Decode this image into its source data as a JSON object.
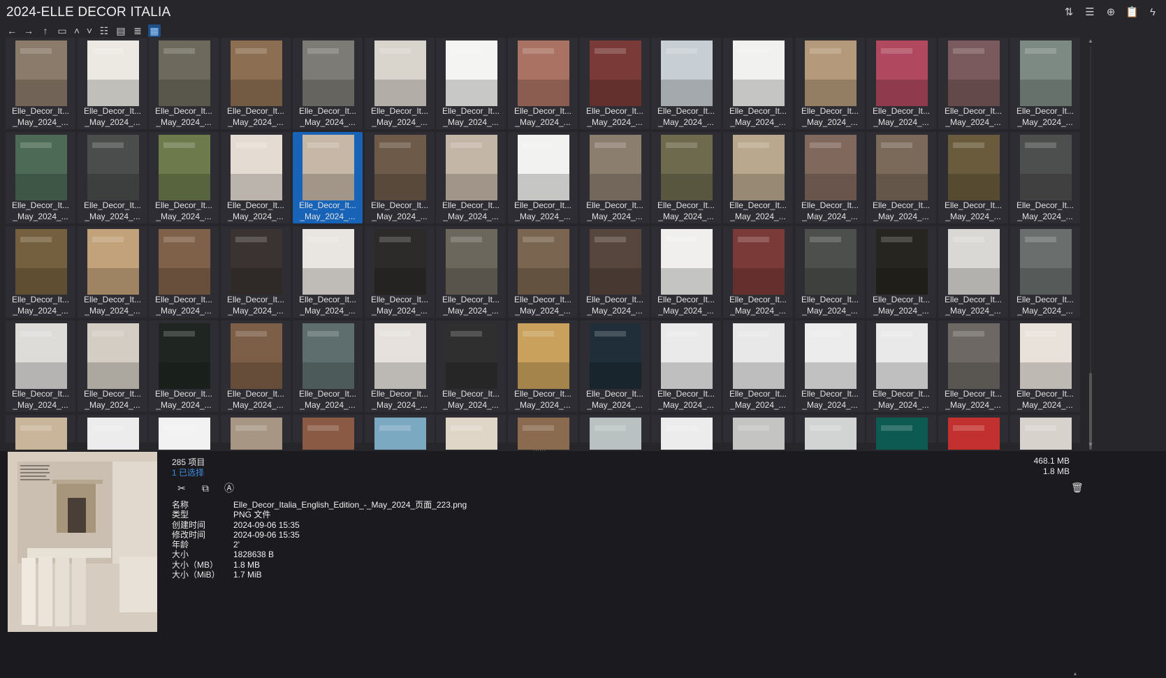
{
  "window": {
    "title": "2024-ELLE DECOR ITALIA"
  },
  "topbar": {
    "icons": [
      "sort-icon",
      "list-view-icon",
      "add-icon",
      "clipboard-icon",
      "lightning-icon"
    ]
  },
  "toolbar": {
    "icons": [
      "back-arrow-icon",
      "forward-arrow-icon",
      "up-arrow-icon",
      "window-icon",
      "chevron-up-icon",
      "chevron-down-icon",
      "details-view-icon",
      "tiles-view-icon",
      "content-view-icon",
      "thumbnail-view-icon"
    ]
  },
  "grid": {
    "caption_line1": "Elle_Decor_It...",
    "caption_line2": "_May_2024_...",
    "columns": 15,
    "rows": 5,
    "selected_index": 19,
    "thumb_colors": [
      [
        "#8a7b6a",
        "#ece9e3",
        "#6d6a5d",
        "#8c6e52",
        "#7d7b75",
        "#d9d4cc",
        "#f4f4f2",
        "#a97262",
        "#7a3b38",
        "#c7cfd4",
        "#f1f1ef",
        "#b49a7a",
        "#b0485f",
        "#7a5a5c",
        "#7d8a84"
      ],
      [
        "#4c6a55",
        "#4b4c4c",
        "#6c7a4c",
        "#e4dcd2",
        "#c6b7a6",
        "#6d5a48",
        "#c4b6a7",
        "#f2f2f0",
        "#8c7e6e",
        "#6d6a4e",
        "#b9a88e",
        "#80685c",
        "#7b6a5a",
        "#6a5b3c",
        "#4d4f4e"
      ],
      [
        "#74603e",
        "#c2a27a",
        "#7e6148",
        "#3a3331",
        "#e9e6e1",
        "#2d2b2a",
        "#6c675c",
        "#7a6550",
        "#57463e",
        "#f0efed",
        "#7a3a38",
        "#4c4f4b",
        "#27251f",
        "#dad8d4",
        "#6a6e6c"
      ],
      [
        "#dddcd9",
        "#d4cdc3",
        "#1f2622",
        "#7d5f47",
        "#5e6e6e",
        "#e6e1dc",
        "#2f2f2f",
        "#c9a15c",
        "#1f2e38",
        "#eaeaea",
        "#e8e8e8",
        "#ececec",
        "#e9e9e9",
        "#6d6863",
        "#e8e2da"
      ],
      [
        "#c8b59a",
        "#ececec",
        "#f2f2f2",
        "#a79683",
        "#8a5a45",
        "#7ca9c2",
        "#e0d6c7",
        "#8a6b50",
        "#b9c1c1",
        "#ececec",
        "#c4c4c2",
        "#d2d4d4",
        "#0d5a52",
        "#c2302f",
        "#d8d2cc"
      ]
    ]
  },
  "details": {
    "item_count": "285 项目",
    "selected_count": "1 已选择",
    "total_size": "468.1 MB",
    "selected_size": "1.8 MB",
    "actions": [
      "cut-icon",
      "copy-icon",
      "rename-icon"
    ],
    "properties": [
      {
        "key": "名称",
        "value": "Elle_Decor_Italia_English_Edition_-_May_2024_页面_223.png"
      },
      {
        "key": "类型",
        "value": "PNG 文件"
      },
      {
        "key": "创建时间",
        "value": "2024-09-06  15:35"
      },
      {
        "key": "修改时间",
        "value": "2024-09-06  15:35"
      },
      {
        "key": "年龄",
        "value": "2'"
      },
      {
        "key": "大小",
        "value": "1828638 B"
      },
      {
        "key": "大小（MB）",
        "value": "1.8 MB"
      },
      {
        "key": "大小（MiB）",
        "value": "1.7 MiB"
      }
    ]
  }
}
